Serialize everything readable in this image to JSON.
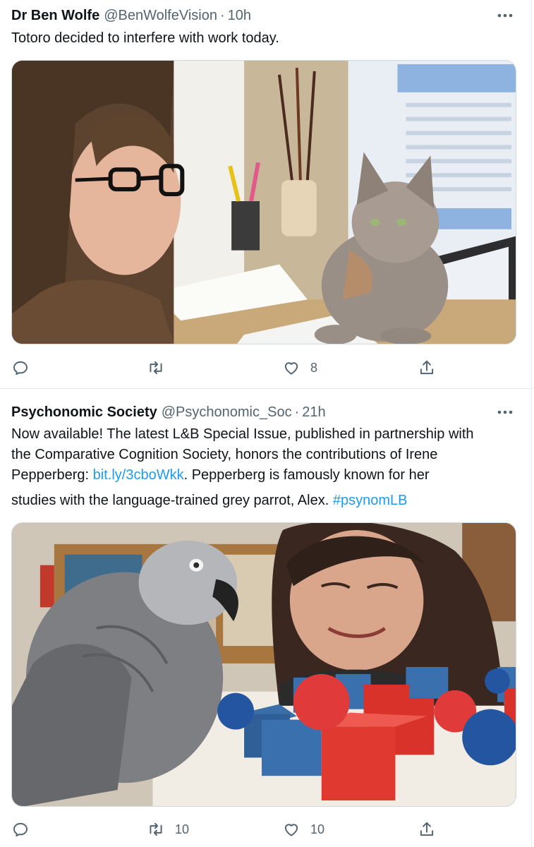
{
  "tweets": [
    {
      "author_name": "Dr Ben Wolfe",
      "handle": "@BenWolfeVision",
      "separator": "·",
      "time": "10h",
      "text": "Totoro decided to interfere with work today.",
      "image_icon": "photo-woman-cat-desk",
      "actions": {
        "reply_count": "",
        "retweet_count": "",
        "like_count": "8"
      }
    },
    {
      "author_name": "Psychonomic Society",
      "handle": "@Psychonomic_Soc",
      "separator": "·",
      "time": "21h",
      "text_line1": "Now available! The latest L&B Special Issue, published in partnership with",
      "text_line2": "the Comparative Cognition Society, honors the contributions of Irene",
      "text_line3_pre": "Pepperberg: ",
      "text_line3_link": "bit.ly/3cboWkk",
      "text_line3_post": ". Pepperberg is famously known for her",
      "text_line4_pre": "studies with the language-trained grey parrot, Alex. ",
      "text_line4_hashtag": "#psynomLB",
      "image_icon": "photo-parrot-woman-blocks",
      "actions": {
        "reply_count": "",
        "retweet_count": "10",
        "like_count": "10"
      }
    }
  ],
  "colors": {
    "link": "#1d9bf0",
    "muted": "#536471",
    "text": "#0f1419",
    "border": "#cfd9de"
  }
}
